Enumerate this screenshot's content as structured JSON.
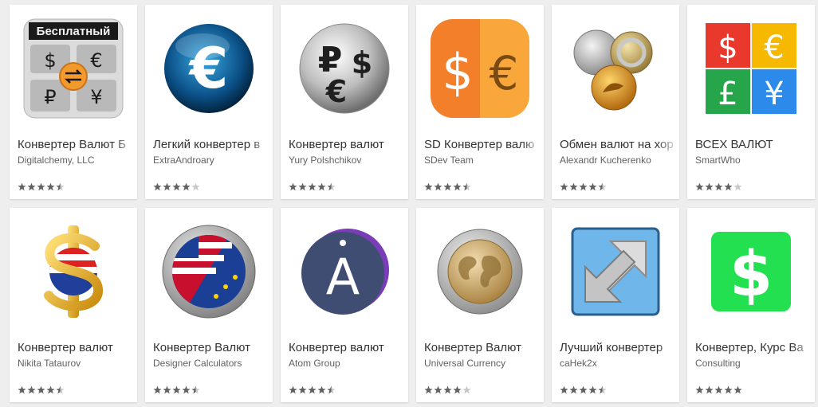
{
  "apps": [
    {
      "id": "digitalchemy",
      "title": "Конвертер Валют Б",
      "developer": "Digitalchemy, LLC",
      "rating": 4.5,
      "icon": "currency-calculator-icon",
      "badge": "Бесплатный"
    },
    {
      "id": "extraandroary",
      "title": "Легкий конвертер в",
      "developer": "ExtraAndroary",
      "rating": 4.0,
      "icon": "euro-blue-icon",
      "glyph": "€"
    },
    {
      "id": "polshchikov",
      "title": "Конвертер валют",
      "developer": "Yury Polshchikov",
      "rating": 4.5,
      "icon": "ruble-dollar-euro-icon",
      "glyph_a": "₽",
      "glyph_b": "$",
      "glyph_c": "€"
    },
    {
      "id": "sdev",
      "title": "SD Конвертер валю",
      "developer": "SDev Team",
      "rating": 4.5,
      "icon": "dollar-euro-orange-icon",
      "glyph_a": "$",
      "glyph_b": "€"
    },
    {
      "id": "kucherenko",
      "title": "Обмен валют на хор",
      "developer": "Alexandr Kucherenko",
      "rating": 4.5,
      "icon": "coins-icon"
    },
    {
      "id": "smartwho",
      "title": "ВСЕХ ВАЛЮТ",
      "developer": "SmartWho",
      "rating": 4.0,
      "icon": "four-currencies-icon",
      "glyph_a": "$",
      "glyph_b": "€",
      "glyph_c": "£",
      "glyph_d": "¥"
    },
    {
      "id": "tataurov",
      "title": "Конвертер валют",
      "developer": "Nikita Tataurov",
      "rating": 4.5,
      "icon": "gold-dollar-flag-icon"
    },
    {
      "id": "designer",
      "title": "Конвертер Валют",
      "developer": "Designer Calculators",
      "rating": 4.5,
      "icon": "us-eu-coin-icon"
    },
    {
      "id": "atom",
      "title": "Конвертер валют",
      "developer": "Atom Group",
      "rating": 4.5,
      "icon": "atom-a-icon",
      "glyph": "A"
    },
    {
      "id": "universal",
      "title": "Конвертер Валют",
      "developer": "Universal Currency",
      "rating": 4.0,
      "icon": "euro-coin-world-icon"
    },
    {
      "id": "cahek2x",
      "title": "Лучший конвертер",
      "developer": "caHek2x",
      "rating": 4.5,
      "icon": "swap-arrows-icon"
    },
    {
      "id": "consulting",
      "title": "Конвертер, Курс Ва",
      "developer": "Consulting",
      "rating": 5.0,
      "icon": "green-dollar-icon",
      "glyph": "$"
    }
  ],
  "colors": {
    "star_filled": "#616161",
    "star_empty": "#c8c8c8",
    "card_bg": "#ffffff",
    "page_bg": "#eeeeee"
  }
}
